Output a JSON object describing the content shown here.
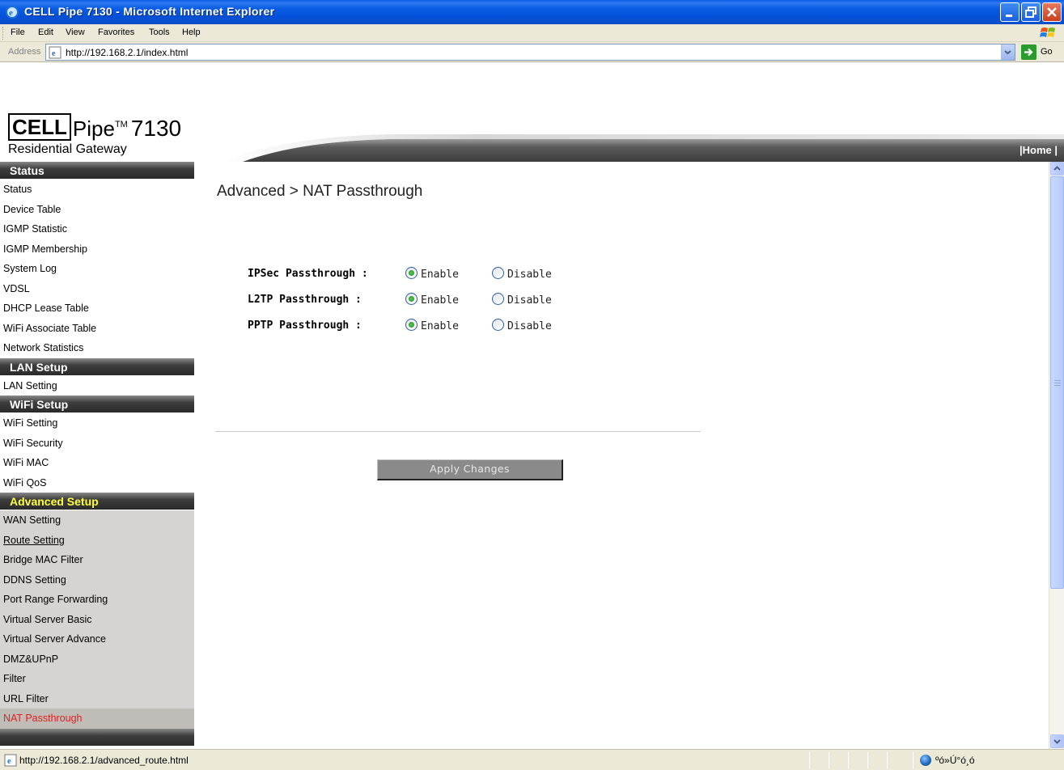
{
  "window": {
    "title": "CELL Pipe 7130 - Microsoft Internet Explorer"
  },
  "menu": [
    "File",
    "Edit",
    "View",
    "Favorites",
    "Tools",
    "Help"
  ],
  "address": {
    "label": "Address",
    "url": "http://192.168.2.1/index.html",
    "go_label": "Go"
  },
  "brand": {
    "cell": "CELL",
    "pipe": "Pipe",
    "tm": "TM",
    "model": "7130",
    "subtitle": "Residential Gateway"
  },
  "header": {
    "home_link": "|Home |"
  },
  "sidebar": {
    "sections": [
      {
        "title": "Status",
        "items": [
          "Status",
          "Device Table",
          "IGMP Statistic",
          "IGMP Membership",
          "System Log",
          "VDSL",
          "DHCP Lease Table",
          "WiFi Associate Table",
          "Network Statistics"
        ]
      },
      {
        "title": "LAN Setup",
        "items": [
          "LAN Setting"
        ]
      },
      {
        "title": "WiFi Setup",
        "items": [
          "WiFi Setting",
          "WiFi Security",
          "WiFi MAC",
          "WiFi QoS"
        ]
      },
      {
        "title": "Advanced Setup",
        "items": [
          "WAN Setting",
          "Route Setting",
          "Bridge MAC Filter",
          "DDNS Setting",
          "Port Range Forwarding",
          "Virtual Server Basic",
          "Virtual Server Advance",
          "DMZ&UPnP",
          "Filter",
          "URL Filter",
          "NAT Passthrough"
        ]
      }
    ]
  },
  "content": {
    "title": "Advanced > NAT Passthrough",
    "rows": [
      {
        "label": "IPSec Passthrough :",
        "enable": "Enable",
        "disable": "Disable",
        "selected": "Enable"
      },
      {
        "label": "L2TP Passthrough :",
        "enable": "Enable",
        "disable": "Disable",
        "selected": "Enable"
      },
      {
        "label": "PPTP Passthrough :",
        "enable": "Enable",
        "disable": "Disable",
        "selected": "Enable"
      }
    ],
    "apply_label": "Apply Changes"
  },
  "statusbar": {
    "text": "http://192.168.2.1/advanced_route.html",
    "zone": "ºó»Ú°ó¸ó"
  },
  "colors": {
    "titlebar": "#0a5ce4",
    "sidebar_header": "#2a2a2a",
    "active_section": "#ffff3c",
    "current_item": "#e52020",
    "advanced_bg": "#d7d3d0"
  }
}
